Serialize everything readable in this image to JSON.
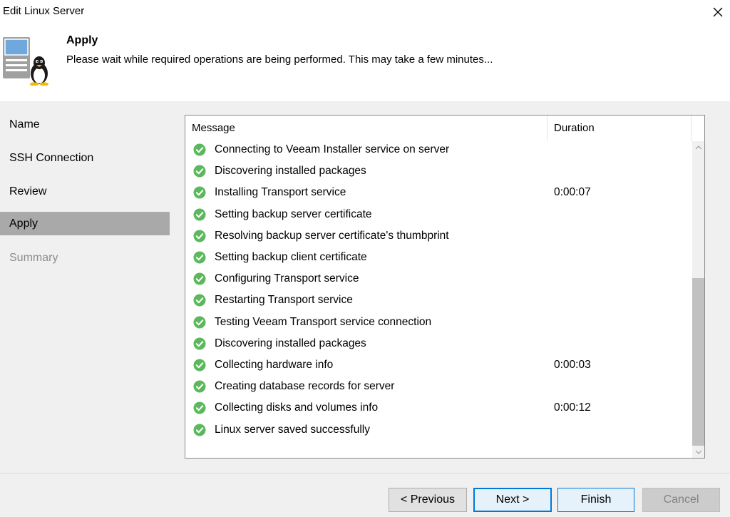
{
  "window": {
    "title": "Edit Linux Server"
  },
  "header": {
    "title": "Apply",
    "subtitle": "Please wait while required operations are being performed. This may take a few minutes..."
  },
  "nav": {
    "items": [
      {
        "label": "Name",
        "state": "normal"
      },
      {
        "label": "SSH Connection",
        "state": "normal"
      },
      {
        "label": "Review",
        "state": "normal"
      },
      {
        "label": "Apply",
        "state": "active"
      },
      {
        "label": "Summary",
        "state": "disabled"
      }
    ]
  },
  "log": {
    "columns": {
      "message": "Message",
      "duration": "Duration"
    },
    "rows": [
      {
        "status": "success",
        "message": "Connecting to Veeam Installer service on server",
        "duration": ""
      },
      {
        "status": "success",
        "message": "Discovering installed packages",
        "duration": ""
      },
      {
        "status": "success",
        "message": "Installing Transport service",
        "duration": "0:00:07"
      },
      {
        "status": "success",
        "message": "Setting backup server certificate",
        "duration": ""
      },
      {
        "status": "success",
        "message": "Resolving backup server certificate's thumbprint",
        "duration": ""
      },
      {
        "status": "success",
        "message": "Setting backup client certificate",
        "duration": ""
      },
      {
        "status": "success",
        "message": "Configuring Transport service",
        "duration": ""
      },
      {
        "status": "success",
        "message": "Restarting Transport service",
        "duration": ""
      },
      {
        "status": "success",
        "message": "Testing Veeam Transport service connection",
        "duration": ""
      },
      {
        "status": "success",
        "message": "Discovering installed packages",
        "duration": ""
      },
      {
        "status": "success",
        "message": "Collecting hardware info",
        "duration": "0:00:03"
      },
      {
        "status": "success",
        "message": "Creating database records for server",
        "duration": ""
      },
      {
        "status": "success",
        "message": "Collecting disks and volumes info",
        "duration": "0:00:12"
      },
      {
        "status": "success",
        "message": "Linux server saved successfully",
        "duration": ""
      }
    ],
    "scroll_position": 1.0
  },
  "buttons": {
    "previous": "< Previous",
    "next": "Next >",
    "finish": "Finish",
    "cancel": "Cancel"
  },
  "icons": {
    "close": "close-icon",
    "server": "linux-server-icon",
    "check": "success-check-icon",
    "scroll_up": "chevron-up-icon",
    "scroll_down": "chevron-down-icon"
  },
  "colors": {
    "success": "#5cb85c",
    "accent": "#0078d7",
    "nav_active": "#a9a9a9"
  }
}
